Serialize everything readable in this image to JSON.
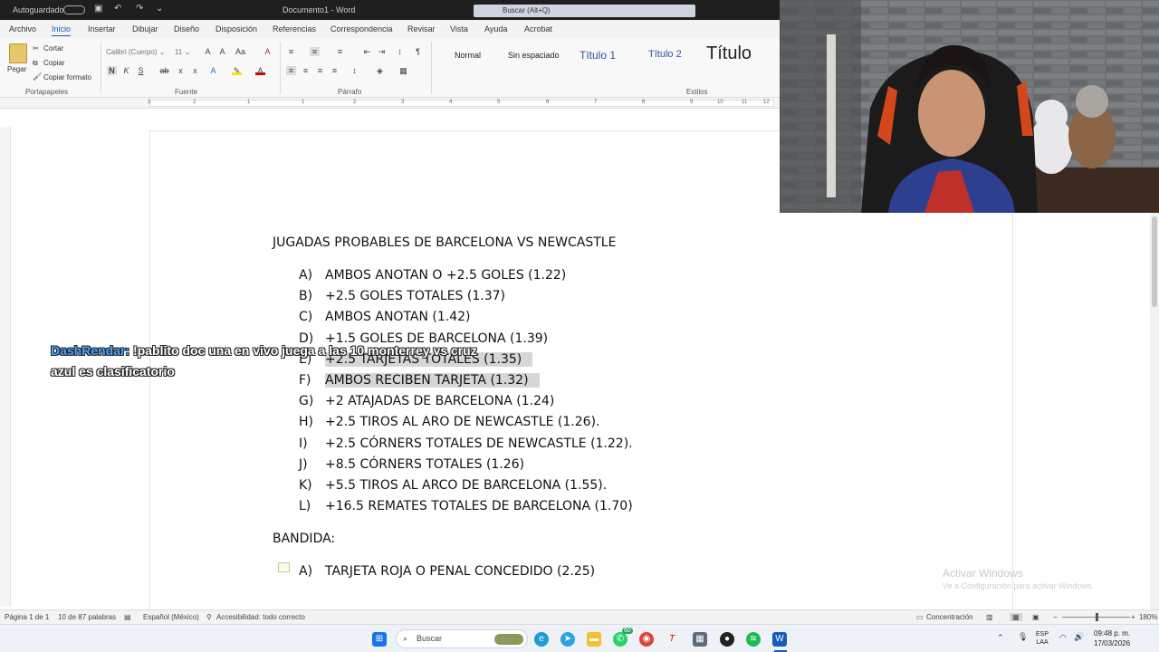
{
  "window": {
    "autosave_label": "Autoguardado",
    "document_title": "Documento1 - Word",
    "search_placeholder": "Buscar (Alt+Q)"
  },
  "menu_tabs": [
    "Archivo",
    "Inicio",
    "Insertar",
    "Dibujar",
    "Diseño",
    "Disposición",
    "Referencias",
    "Correspondencia",
    "Revisar",
    "Vista",
    "Ayuda",
    "Acrobat"
  ],
  "ribbon": {
    "clipboard": {
      "paste": "Pegar",
      "cut": "Cortar",
      "copy": "Copiar",
      "format_painter": "Copiar formato",
      "group_label": "Portapapeles"
    },
    "font": {
      "font_name": "Calibri (Cuerpo)",
      "font_size": "11",
      "group_label": "Fuente"
    },
    "paragraph": {
      "group_label": "Párrafo"
    },
    "styles": {
      "items": [
        "Normal",
        "Sin espaciado",
        "Título 1",
        "Título 2",
        "Título"
      ],
      "group_label": "Estilos"
    }
  },
  "ruler_ticks": [
    "3",
    "2",
    "1",
    "1",
    "2",
    "3",
    "4",
    "5",
    "6",
    "7",
    "8",
    "9",
    "10",
    "11",
    "12"
  ],
  "document": {
    "heading": "JUGADAS PROBABLES DE BARCELONA VS NEWCASTLE",
    "items": [
      {
        "letter": "A)",
        "text": "AMBOS ANOTAN O +2.5 GOLES (1.22)"
      },
      {
        "letter": "B)",
        "text": "+2.5 GOLES TOTALES (1.37)"
      },
      {
        "letter": "C)",
        "text": "AMBOS ANOTAN (1.42)"
      },
      {
        "letter": "D)",
        "text": "+1.5 GOLES DE BARCELONA (1.39)"
      },
      {
        "letter": "E)",
        "text": "+2.5 TARJETAS TOTALES (1.35)"
      },
      {
        "letter": "F)",
        "text": "AMBOS RECIBEN TARJETA (1.32)"
      },
      {
        "letter": "G)",
        "text": "+2 ATAJADAS DE BARCELONA (1.24)"
      },
      {
        "letter": "H)",
        "text": "+2.5 TIROS AL ARO DE NEWCASTLE (1.26)."
      },
      {
        "letter": "I)",
        "text": "+2.5 CÓRNERS TOTALES DE NEWCASTLE (1.22)."
      },
      {
        "letter": "J)",
        "text": "+8.5 CÓRNERS TOTALES (1.26)"
      },
      {
        "letter": "K)",
        "text": "+5.5 TIROS AL ARCO DE BARCELONA (1.55)."
      },
      {
        "letter": "L)",
        "text": "+16.5 REMATES TOTALES DE BARCELONA (1.70)"
      }
    ],
    "bandida_heading": "BANDIDA:",
    "bandida_items": [
      {
        "letter": "A)",
        "text": "TARJETA ROJA O PENAL CONCEDIDO (2.25)"
      }
    ]
  },
  "chat_overlay": {
    "user": "DashRendar:",
    "message": " !pablito doc una en vivo juega a las 10 monterrey vs cruz azul es clasificatorio"
  },
  "watermark": {
    "title": "Activar Windows",
    "subtitle": "Ve a Configuración para activar Windows."
  },
  "status_bar": {
    "page": "Página 1 de 1",
    "words": "10 de 87 palabras",
    "language": "Español (México)",
    "accessibility": "Accesibilidad: todo correcto",
    "focus": "Concentración",
    "zoom": "180%"
  },
  "taskbar": {
    "search_placeholder": "Buscar",
    "whatsapp_badge": "60",
    "lang": "ESP",
    "lang2": "LAA",
    "time": "09:48 p. m.",
    "date": "17/03/2026"
  }
}
